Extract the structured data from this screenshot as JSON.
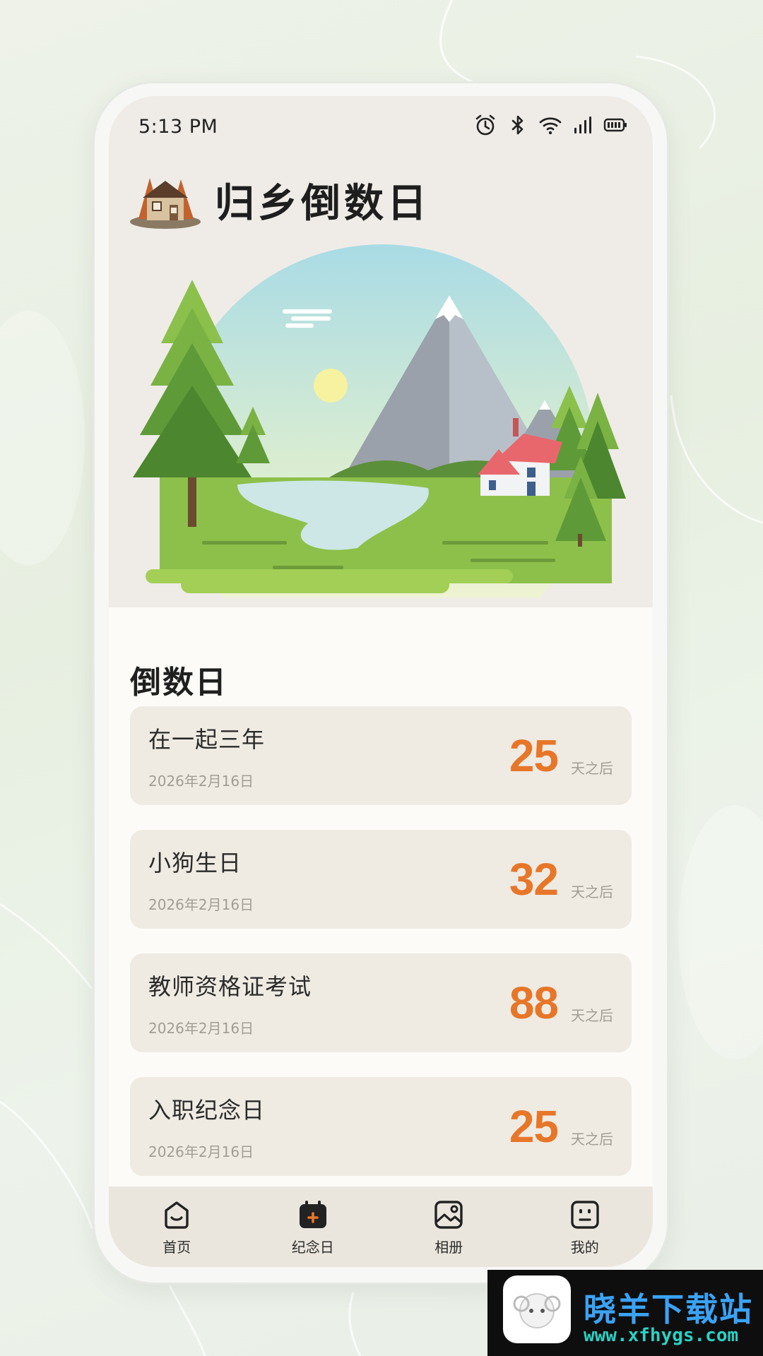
{
  "status_bar": {
    "time": "5:13 PM"
  },
  "header": {
    "title": "归乡倒数日"
  },
  "countdown": {
    "section_title": "倒数日",
    "items": [
      {
        "title": "在一起三年",
        "date": "2026年2月16日",
        "days": "25",
        "suffix": "天之后"
      },
      {
        "title": "小狗生日",
        "date": "2026年2月16日",
        "days": "32",
        "suffix": "天之后"
      },
      {
        "title": "教师资格证考试",
        "date": "2026年2月16日",
        "days": "88",
        "suffix": "天之后"
      },
      {
        "title": "入职纪念日",
        "date": "2026年2月16日",
        "days": "25",
        "suffix": "天之后"
      }
    ]
  },
  "tab_bar": {
    "tabs": [
      {
        "label": "首页",
        "icon": "home-face-icon"
      },
      {
        "label": "纪念日",
        "icon": "calendar-add-icon",
        "active": true
      },
      {
        "label": "相册",
        "icon": "photo-icon"
      },
      {
        "label": "我的",
        "icon": "profile-face-icon"
      }
    ]
  },
  "watermark": {
    "title": "晓羊下载站",
    "url": "www.xfhygs.com"
  },
  "colors": {
    "accent": "#e77629",
    "card": "#efebe3",
    "hero_bg": "#efece7",
    "tab_bg": "#ebe6dd"
  }
}
